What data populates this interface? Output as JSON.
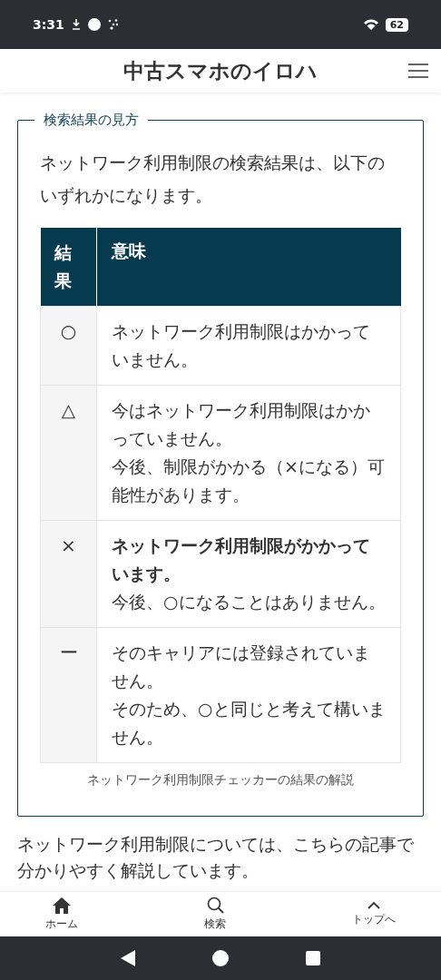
{
  "status_bar": {
    "time": "3:31",
    "battery": "62"
  },
  "header": {
    "title": "中古スマホのイロハ"
  },
  "box": {
    "legend": "検索結果の見方",
    "intro": "ネットワーク利用制限の検索結果は、以下のいずれかになります。",
    "table": {
      "columns": [
        "結果",
        "意味"
      ],
      "rows": [
        {
          "result": "○",
          "lines": [
            "ネットワーク利用制限はかかっていません。"
          ]
        },
        {
          "result": "△",
          "lines": [
            "今はネットワーク利用制限はかかっていません。",
            "今後、制限がかかる（×になる）可能性があります。"
          ]
        },
        {
          "result": "×",
          "lines": [
            "**ネットワーク利用制限がかかっています。**",
            "今後、○になることはありません。"
          ]
        },
        {
          "result": "ー",
          "lines": [
            "そのキャリアには登録されていません。",
            "そのため、○と同じと考えて構いません。"
          ]
        }
      ]
    },
    "caption": "ネットワーク利用制限チェッカーの結果の解説"
  },
  "paragraph": "ネットワーク利用制限については、こちらの記事で分かりやすく解説しています。",
  "bottom_nav": [
    {
      "kind": "home",
      "label": "ホーム"
    },
    {
      "kind": "search",
      "label": "検索"
    },
    {
      "kind": "top",
      "label": "トップへ"
    }
  ]
}
